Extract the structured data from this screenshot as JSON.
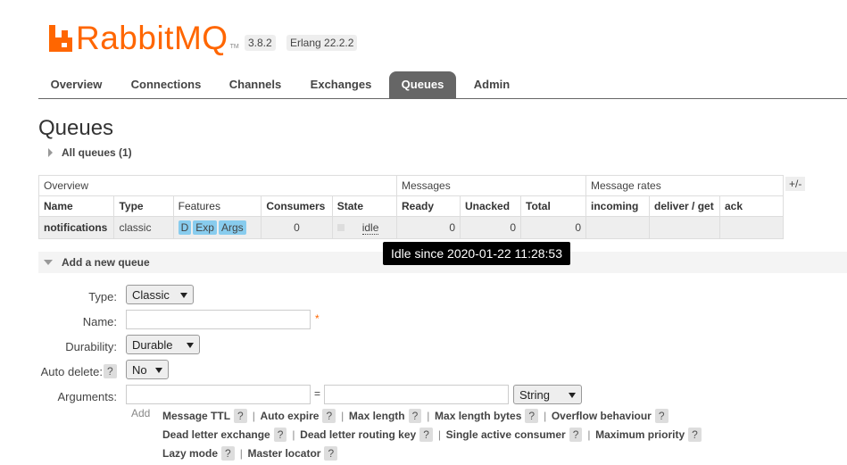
{
  "header": {
    "logo_text": "RabbitMQ",
    "logo_tm": "TM",
    "version": "3.8.2",
    "erlang": "Erlang 22.2.2"
  },
  "tabs": [
    "Overview",
    "Connections",
    "Channels",
    "Exchanges",
    "Queues",
    "Admin"
  ],
  "active_tab": "Queues",
  "page_title": "Queues",
  "all_queues_label": "All queues (1)",
  "table": {
    "groups": [
      "Overview",
      "Messages",
      "Message rates"
    ],
    "toggle_label": "+/-",
    "columns": [
      "Name",
      "Type",
      "Features",
      "Consumers",
      "State",
      "Ready",
      "Unacked",
      "Total",
      "incoming",
      "deliver / get",
      "ack"
    ],
    "row": {
      "name": "notifications",
      "type": "classic",
      "features": [
        "D",
        "Exp",
        "Args"
      ],
      "consumers": "0",
      "state": "idle",
      "ready": "0",
      "unacked": "0",
      "total": "0",
      "incoming": "",
      "deliver_get": "",
      "ack": ""
    },
    "tooltip": "Idle since 2020-01-22 11:28:53"
  },
  "add_queue": {
    "section_label": "Add a new queue",
    "type_label": "Type:",
    "type_value": "Classic",
    "name_label": "Name:",
    "name_value": "",
    "required_mark": "*",
    "durability_label": "Durability:",
    "durability_value": "Durable",
    "auto_delete_label": "Auto delete:",
    "auto_delete_help": "?",
    "auto_delete_value": "No",
    "arguments_label": "Arguments:",
    "arg_key": "",
    "equals": "=",
    "arg_value": "",
    "arg_type": "String",
    "add_label": "Add",
    "arg_shortcuts": [
      "Message TTL",
      "Auto expire",
      "Max length",
      "Max length bytes",
      "Overflow behaviour",
      "Dead letter exchange",
      "Dead letter routing key",
      "Single active consumer",
      "Maximum priority",
      "Lazy mode",
      "Master locator"
    ]
  }
}
